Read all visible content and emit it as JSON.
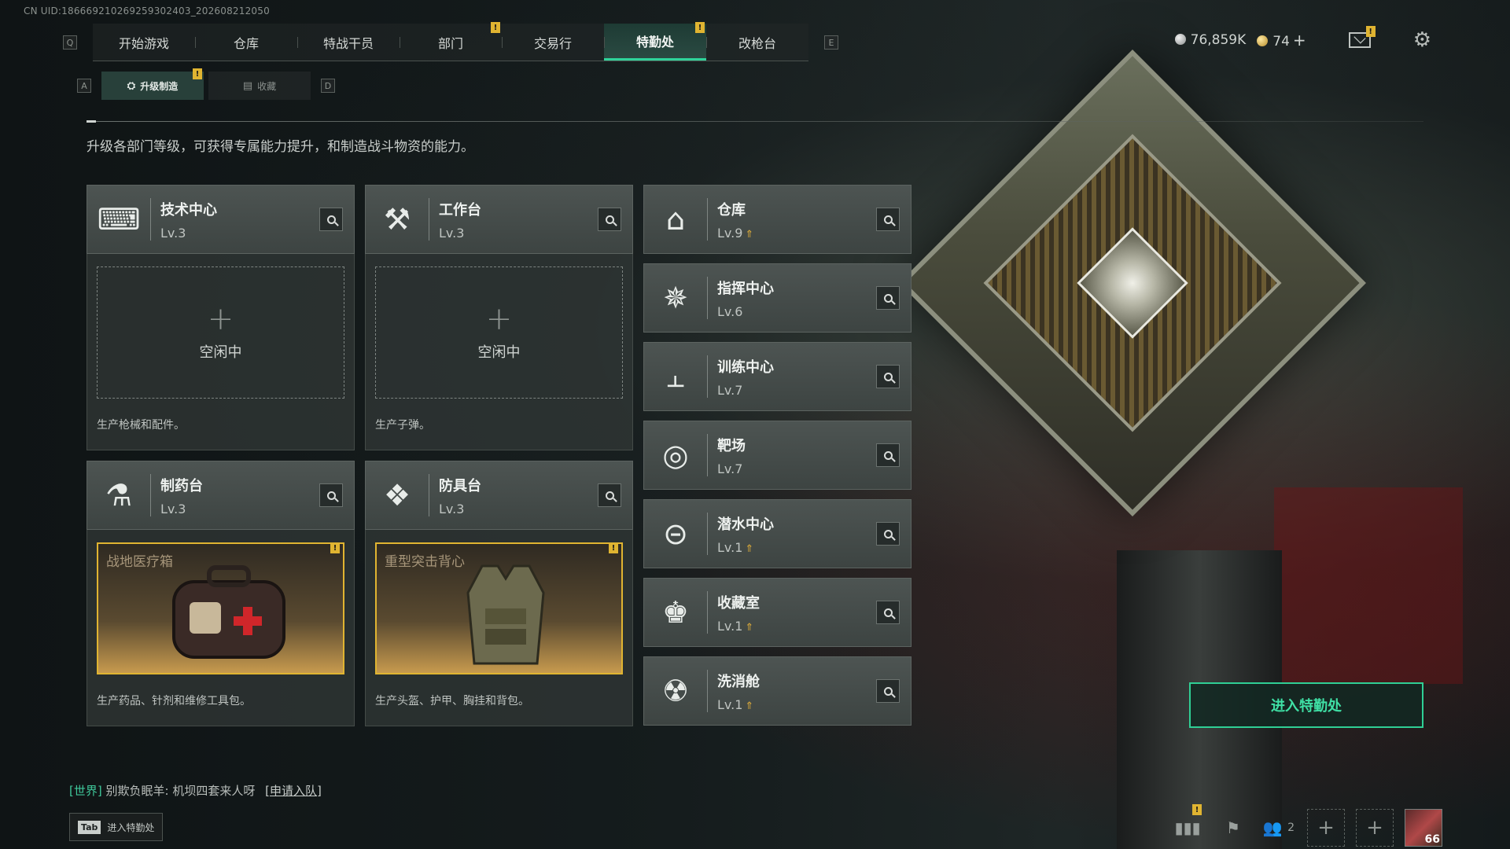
{
  "uid": "CN UID:186669210269259302403_202608212050",
  "nav": {
    "keys": {
      "left": "Q",
      "right": "E"
    },
    "tabs": [
      {
        "label": "开始游戏"
      },
      {
        "label": "仓库"
      },
      {
        "label": "特战干员"
      },
      {
        "label": "部门",
        "badge": "!"
      },
      {
        "label": "交易行"
      },
      {
        "label": "特勤处",
        "badge": "!",
        "active": true
      },
      {
        "label": "改枪台"
      }
    ]
  },
  "currency": {
    "silver": "76,859K",
    "gold": "74",
    "mail_badge": "!"
  },
  "subnav": {
    "keys": {
      "left": "A",
      "right": "D"
    },
    "tabs": [
      {
        "label": "升级制造",
        "badge": "!",
        "active": true
      },
      {
        "label": "收藏"
      }
    ]
  },
  "description": "升级各部门等级，可获得专属能力提升，和制造战斗物资的能力。",
  "facilities_left": [
    {
      "name": "技术中心",
      "level": "Lv.3",
      "icon": "computer-icon",
      "glyph": "⌨",
      "state": "idle",
      "idle_label": "空闲中",
      "desc": "生产枪械和配件。"
    },
    {
      "name": "工作台",
      "level": "Lv.3",
      "icon": "hammer-wrench-icon",
      "glyph": "⚒",
      "state": "idle",
      "idle_label": "空闲中",
      "desc": "生产子弹。"
    },
    {
      "name": "制药台",
      "level": "Lv.3",
      "icon": "microscope-icon",
      "glyph": "⚗",
      "state": "producing",
      "product": "战地医疗箱",
      "badge": "!",
      "desc": "生产药品、针剂和维修工具包。"
    },
    {
      "name": "防具台",
      "level": "Lv.3",
      "icon": "cubes-icon",
      "glyph": "❖",
      "state": "producing",
      "product": "重型突击背心",
      "badge": "!",
      "desc": "生产头盔、护甲、胸挂和背包。"
    }
  ],
  "facilities_right": [
    {
      "name": "仓库",
      "level": "Lv.9",
      "upgradable": true,
      "icon": "warehouse-icon",
      "glyph": "⌂"
    },
    {
      "name": "指挥中心",
      "level": "Lv.6",
      "upgradable": false,
      "icon": "command-icon",
      "glyph": "✵"
    },
    {
      "name": "训练中心",
      "level": "Lv.7",
      "upgradable": false,
      "icon": "dumbbell-icon",
      "glyph": "⫠"
    },
    {
      "name": "靶场",
      "level": "Lv.7",
      "upgradable": false,
      "icon": "target-icon",
      "glyph": "◎"
    },
    {
      "name": "潜水中心",
      "level": "Lv.1",
      "upgradable": true,
      "icon": "diving-mask-icon",
      "glyph": "⊝"
    },
    {
      "name": "收藏室",
      "level": "Lv.1",
      "upgradable": true,
      "icon": "collection-icon",
      "glyph": "♚"
    },
    {
      "name": "洗消舱",
      "level": "Lv.1",
      "upgradable": true,
      "icon": "decon-icon",
      "glyph": "☢"
    }
  ],
  "enter_button": "进入特勤处",
  "chat": {
    "channel": "[世界]",
    "sender": "别欺负眠羊",
    "message": "机坝四套来人呀",
    "link": "[申请入队]"
  },
  "tab_hint": {
    "key": "Tab",
    "label": "进入特勤处"
  },
  "bottom": {
    "friends_count": "2",
    "avatar_level": "66",
    "stats_badge": "!"
  },
  "colors": {
    "accent": "#2fd39a",
    "badge": "#e0b431",
    "panel": "#4d5452"
  }
}
